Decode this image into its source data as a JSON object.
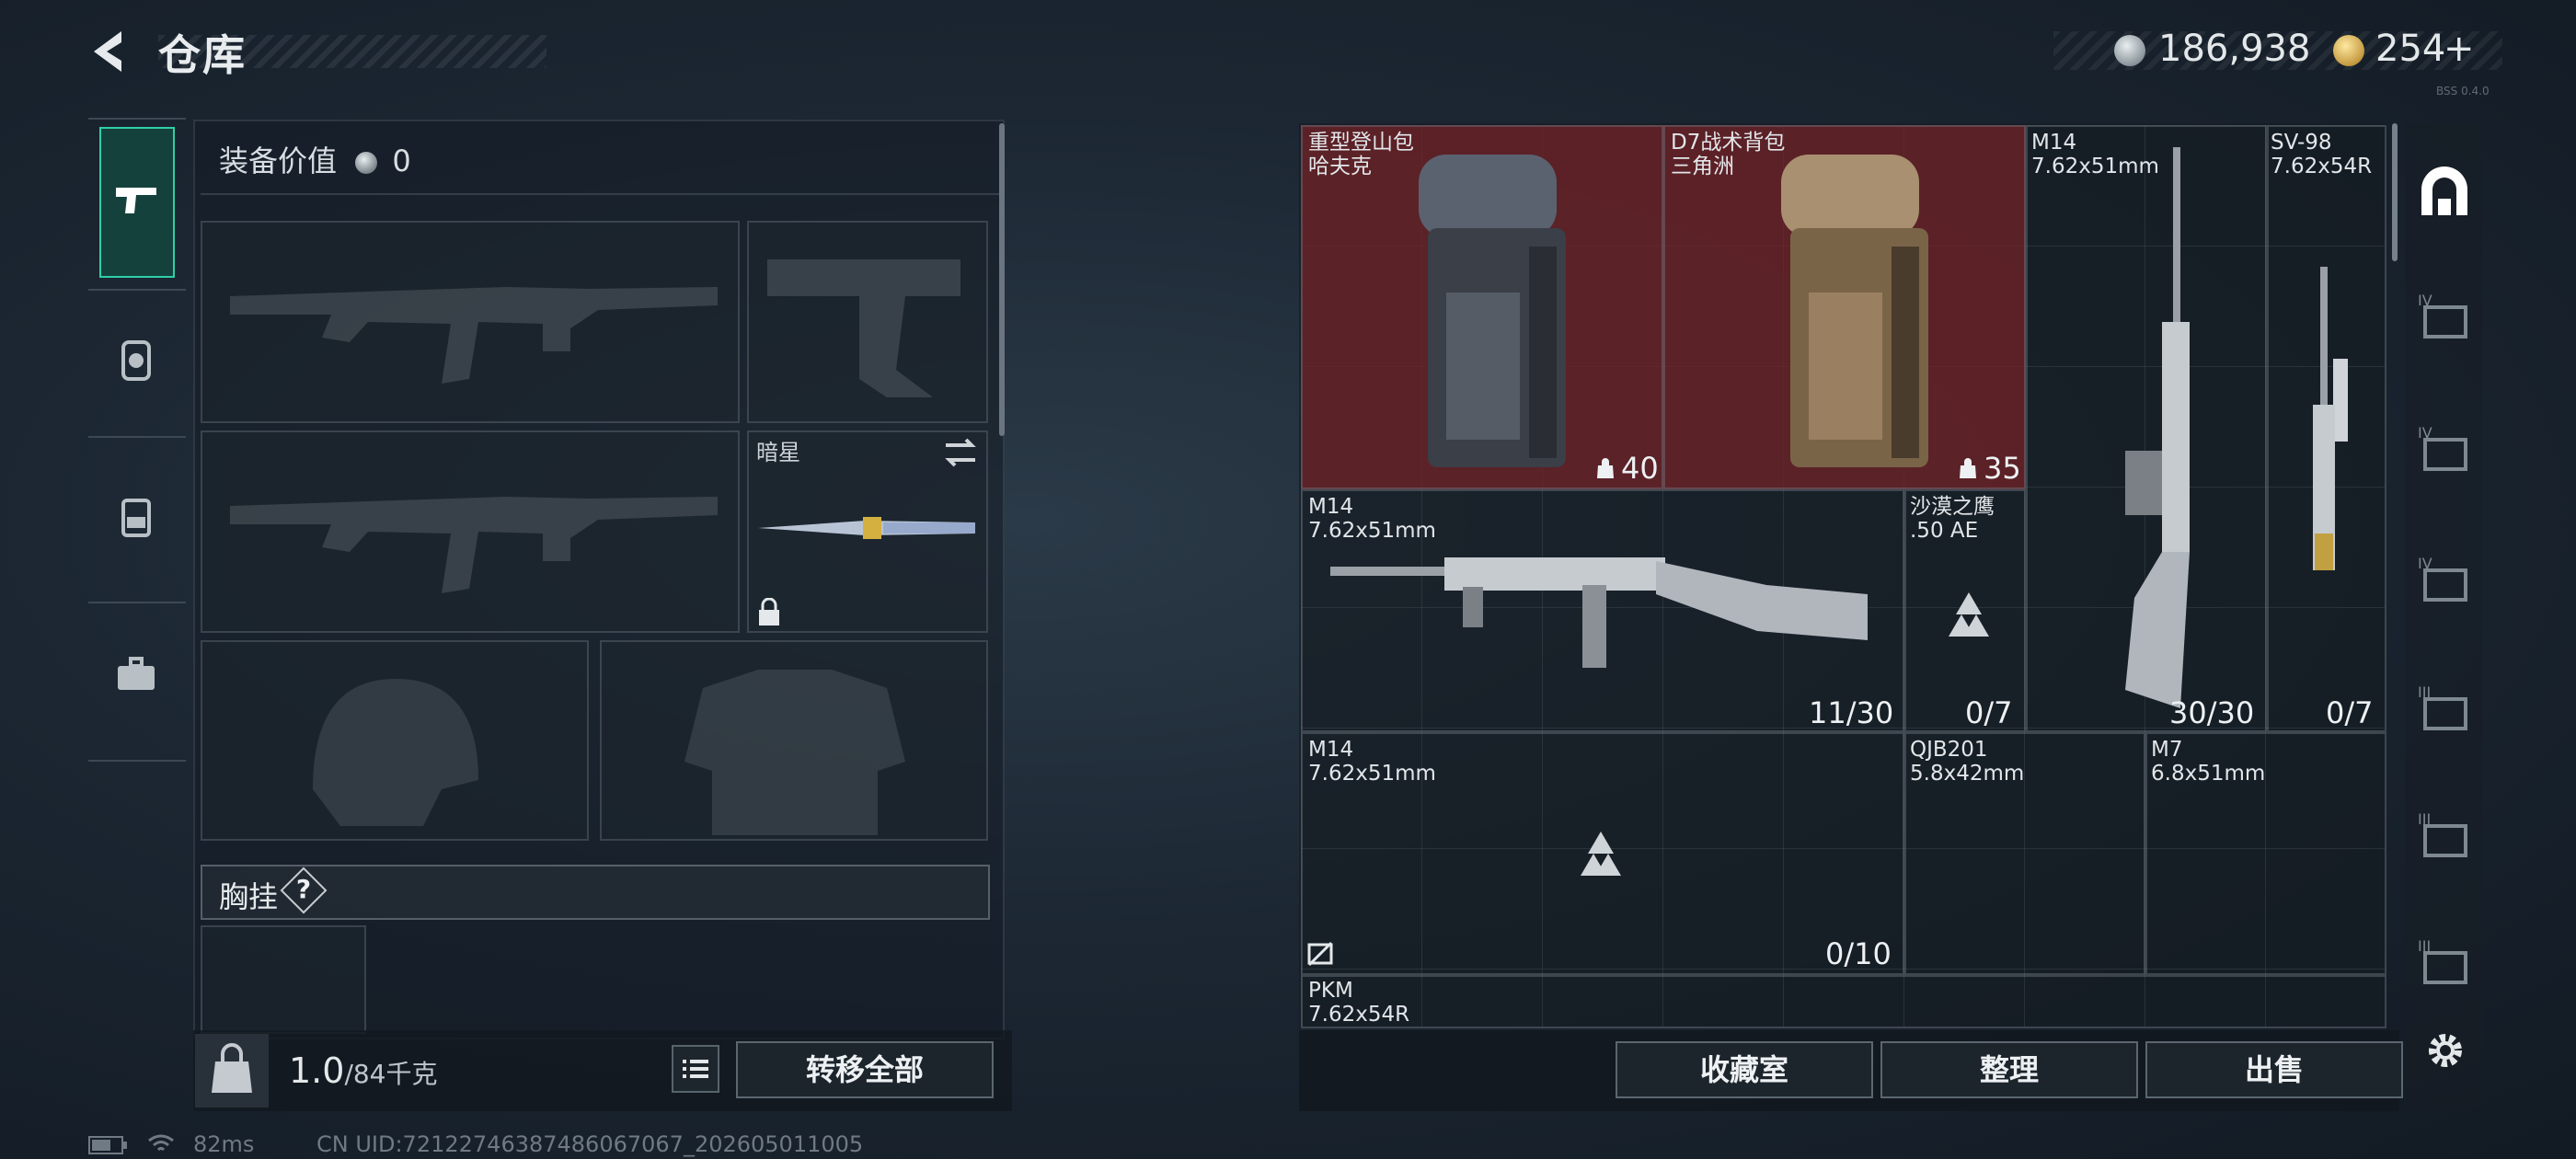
{
  "header": {
    "title": "仓库",
    "silver_amount": "186,938",
    "gold_amount": "254",
    "gold_add": "+",
    "version_note": "BSS 0.4.0"
  },
  "sidebar": {
    "items": [
      {
        "name": "weapons-tab",
        "icon": "pistol-icon",
        "active": true
      },
      {
        "name": "gear-tab",
        "icon": "backpack-helmet-icon",
        "active": false
      },
      {
        "name": "backpack-tab",
        "icon": "backpack-icon",
        "active": false
      },
      {
        "name": "toolbox-tab",
        "icon": "toolbox-icon",
        "active": false
      }
    ]
  },
  "loadout": {
    "equip_value_label": "装备价值",
    "equip_value": "0",
    "melee_label": "暗星",
    "chest_label": "胸挂",
    "help": "?"
  },
  "bottom_left": {
    "bag_icon": "bag-kg-icon",
    "weight_current": "1.0",
    "weight_max": "/84千克",
    "transfer_all": "转移全部"
  },
  "stash": {
    "items": [
      {
        "name": "重型登山包",
        "sub": "哈夫克",
        "count": "40",
        "red": true
      },
      {
        "name": "D7战术背包",
        "sub": "三角洲",
        "count": "35",
        "red": true
      },
      {
        "name": "M14",
        "sub": "7.62x51mm",
        "count": "30/30"
      },
      {
        "name": "SV-98",
        "sub": "7.62x54R",
        "count": "0/7"
      },
      {
        "name": "M14",
        "sub": "7.62x51mm",
        "count": "11/30"
      },
      {
        "name": "沙漠之鹰",
        "sub": ".50 AE",
        "count": "0/7"
      },
      {
        "name": "M14",
        "sub": "7.62x51mm",
        "count": "0/10"
      },
      {
        "name": "QJB201",
        "sub": "5.8x42mm",
        "count": ""
      },
      {
        "name": "M7",
        "sub": "6.8x51mm",
        "count": ""
      },
      {
        "name": "PKM",
        "sub": "7.62x54R",
        "count": ""
      }
    ],
    "buttons": {
      "collection": "收藏室",
      "organize": "整理",
      "sell": "出售"
    }
  },
  "right_filters": [
    {
      "icon": "arch-filter-icon"
    },
    {
      "icon": "tier-iv-icon",
      "tier": "IV"
    },
    {
      "icon": "tier-iv-icon",
      "tier": "IV"
    },
    {
      "icon": "tier-iv-icon",
      "tier": "IV"
    },
    {
      "icon": "tier-iii-icon",
      "tier": "III"
    },
    {
      "icon": "tier-iii-icon",
      "tier": "III"
    },
    {
      "icon": "tier-iii-icon",
      "tier": "III"
    },
    {
      "icon": "gear-settings-icon"
    }
  ],
  "status": {
    "ping": "82ms",
    "uid": "CN UID:72122746387486067067_202605011005"
  },
  "colors": {
    "accent": "#2ecfa8",
    "red_slot": "#6e2228"
  }
}
